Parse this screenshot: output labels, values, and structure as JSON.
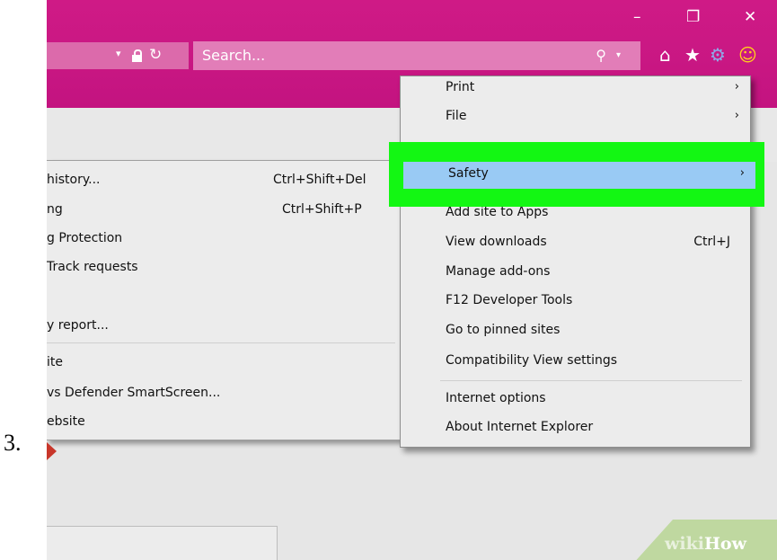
{
  "step_number": "3.",
  "window": {
    "minimize": "–",
    "restore": "❐",
    "close": "✕"
  },
  "address_bar": {
    "dropdown_glyph": "▾",
    "refresh_glyph": "↻"
  },
  "search": {
    "placeholder": "Search...",
    "search_glyph": "⚲",
    "dropdown_glyph": "▾"
  },
  "toolbar_icons": [
    {
      "name": "home-icon",
      "glyph": "⌂"
    },
    {
      "name": "favorites-star-icon",
      "glyph": "★"
    },
    {
      "name": "tools-gear-icon",
      "glyph": "⚙"
    },
    {
      "name": "feedback-smiley-icon",
      "glyph": "☺"
    }
  ],
  "safety_submenu": {
    "items": [
      {
        "label": "history...",
        "shortcut": "Ctrl+Shift+Del"
      },
      {
        "label": "ng",
        "shortcut": "Ctrl+Shift+P"
      },
      {
        "label": "g Protection",
        "shortcut": ""
      },
      {
        "label": "Track requests",
        "shortcut": ""
      },
      {
        "label": "",
        "shortcut": ""
      },
      {
        "label": "y report...",
        "shortcut": ""
      },
      {
        "label": "ite",
        "shortcut": ""
      },
      {
        "label": "vs Defender SmartScreen...",
        "shortcut": ""
      },
      {
        "label": "ebsite",
        "shortcut": ""
      }
    ]
  },
  "tools_menu": {
    "items": [
      {
        "label": "Print",
        "submenu_arrow": "›",
        "shortcut": ""
      },
      {
        "label": "File",
        "submenu_arrow": "›",
        "shortcut": ""
      },
      {
        "label": "Safety",
        "submenu_arrow": "›",
        "shortcut": "",
        "highlighted": true
      },
      {
        "label": "Add site to Apps",
        "submenu_arrow": "",
        "shortcut": ""
      },
      {
        "label": "View downloads",
        "submenu_arrow": "",
        "shortcut": "Ctrl+J"
      },
      {
        "label": "Manage add-ons",
        "submenu_arrow": "",
        "shortcut": ""
      },
      {
        "label": "F12 Developer Tools",
        "submenu_arrow": "",
        "shortcut": ""
      },
      {
        "label": "Go to pinned sites",
        "submenu_arrow": "",
        "shortcut": ""
      },
      {
        "label": "Compatibility View settings",
        "submenu_arrow": "",
        "shortcut": ""
      },
      {
        "label": "Internet options",
        "submenu_arrow": "",
        "shortcut": ""
      },
      {
        "label": "About Internet Explorer",
        "submenu_arrow": "",
        "shortcut": ""
      }
    ]
  },
  "watermark": {
    "wiki": "wiki",
    "how": "How"
  },
  "colors": {
    "title_bar": "#c91783",
    "menu_background": "#ececec",
    "selection_highlight": "#99caf4",
    "callout_green": "#13f713"
  }
}
